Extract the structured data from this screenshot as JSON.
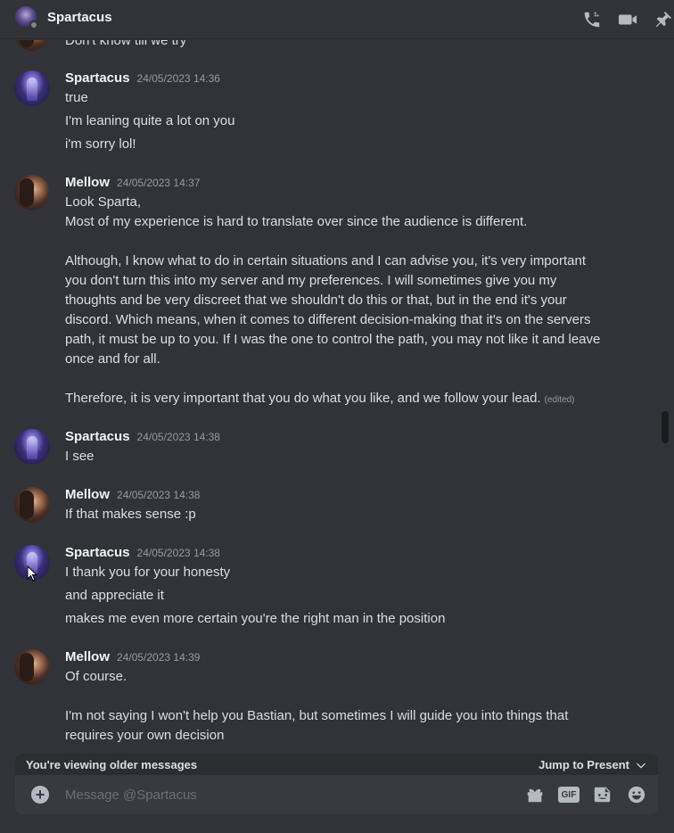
{
  "header": {
    "title": "Spartacus",
    "icons": [
      "phone-call-icon",
      "video-call-icon",
      "pin-icon"
    ]
  },
  "messages": [
    {
      "author": "",
      "timestamp": "",
      "lines": [
        "Don't know till we try"
      ]
    },
    {
      "author": "Spartacus",
      "timestamp": "24/05/2023 14:36",
      "lines": [
        "true",
        "I'm leaning quite a lot on you",
        "i'm sorry lol!"
      ]
    },
    {
      "author": "Mellow",
      "timestamp": "24/05/2023 14:37",
      "lines": [
        "Look Sparta,",
        "Most of my experience is hard to translate over since the audience is different.",
        "",
        "Although, I know what to do in certain situations and I can advise you, it's very important",
        "you don't turn this into my server and my preferences. I will sometimes give you my",
        "thoughts and be very discreet that we shouldn't do this or that, but in the end it's your",
        "discord. Which means, when it comes to different decision-making that it's on the servers",
        "path, it must be up to you. If I was the one to control the path, you may not like it and leave",
        "once and for all.",
        "",
        "Therefore, it is very important that you do what you like, and we follow your lead."
      ],
      "edited": "(edited)"
    },
    {
      "author": "Spartacus",
      "timestamp": "24/05/2023 14:38",
      "lines": [
        "I see"
      ]
    },
    {
      "author": "Mellow",
      "timestamp": "24/05/2023 14:38",
      "lines": [
        "If that makes sense :p"
      ]
    },
    {
      "author": "Spartacus",
      "timestamp": "24/05/2023 14:38",
      "lines": [
        "I thank you for your honesty",
        "and appreciate it",
        "makes me even more certain you're the right man in the position"
      ]
    },
    {
      "author": "Mellow",
      "timestamp": "24/05/2023 14:39",
      "lines": [
        "Of course.",
        "",
        "I'm not saying I won't help you Bastian, but sometimes I will guide you into things that",
        "requires your own decision"
      ]
    }
  ],
  "older_banner": {
    "text": "You're viewing older messages",
    "jump_label": "Jump to Present"
  },
  "composer": {
    "placeholder": "Message @Spartacus",
    "gif_label": "GIF",
    "icons": [
      "add-attachment-icon",
      "gift-icon",
      "gif-icon",
      "sticker-icon",
      "emoji-icon"
    ]
  }
}
